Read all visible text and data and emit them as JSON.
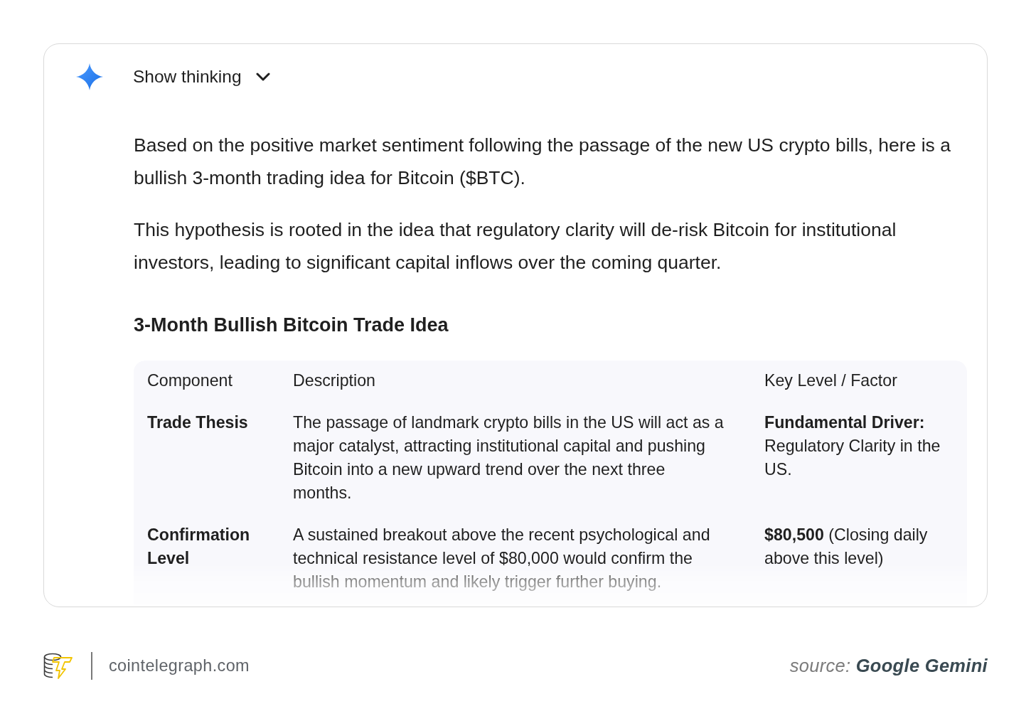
{
  "assistant": {
    "thinking_toggle": {
      "label": "Show thinking",
      "expanded": false
    }
  },
  "response": {
    "paragraphs": [
      "Based on the positive market sentiment following the passage of the new US crypto bills, here is a bullish 3-month trading idea for Bitcoin ($BTC).",
      "This hypothesis is rooted in the idea that regulatory clarity will de-risk Bitcoin for institutional investors, leading to significant capital inflows over the coming quarter."
    ],
    "heading": "3-Month Bullish Bitcoin Trade Idea",
    "table": {
      "columns": [
        "Component",
        "Description",
        "Key Level / Factor"
      ],
      "rows": [
        {
          "component": "Trade Thesis",
          "description": "The passage of landmark crypto bills in the US will act as a major catalyst, attracting institutional capital and pushing Bitcoin into a new upward trend over the next three months.",
          "key_level": "**Fundamental Driver:** Regulatory Clarity in the US."
        },
        {
          "component": "Confirmation Level",
          "description": "A sustained breakout above the recent psychological and technical resistance level of $80,000 would confirm the bullish momentum and likely trigger further buying.",
          "key_level": "**$80,500** (Closing daily above this level)"
        }
      ]
    }
  },
  "footer": {
    "site": "cointelegraph.com",
    "source": "source: **Google Gemini**"
  }
}
